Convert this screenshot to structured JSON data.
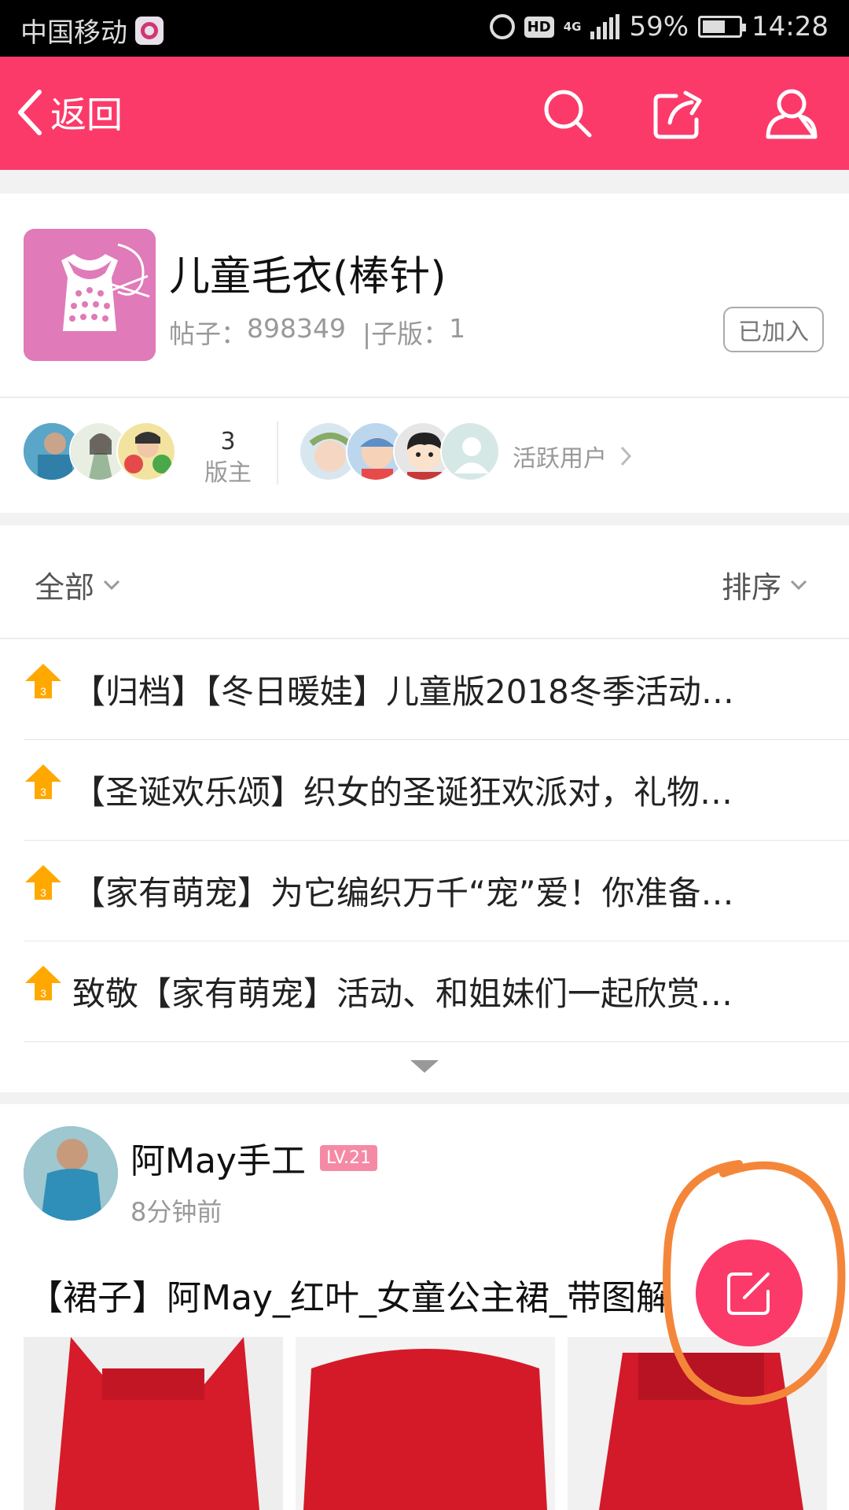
{
  "status_bar": {
    "carrier": "中国移动",
    "network": "4G",
    "battery": "59%",
    "time": "14:28"
  },
  "header": {
    "back_label": "返回"
  },
  "forum": {
    "title": "儿童毛衣(棒针)",
    "posts_label": "帖子：",
    "posts_count": "898349",
    "subforum_label": "  |子版：",
    "subforum_count": "1",
    "joined_label": "已加入"
  },
  "members": {
    "moderator_count": "3",
    "moderator_label": "版主",
    "active_users_label": "活跃用户"
  },
  "filter": {
    "all_label": "全部",
    "sort_label": "排序"
  },
  "pinned_posts": [
    "【归档】【冬日暖娃】儿童版2018冬季活动…",
    "【圣诞欢乐颂】织女的圣诞狂欢派对，礼物…",
    "【家有萌宠】为它编织万千“宠”爱！你准备…",
    "致敬【家有萌宠】活动、和姐妹们一起欣赏…"
  ],
  "post": {
    "author": "阿May手工",
    "level": "LV.21",
    "time": "8分钟前",
    "title": "【裙子】阿May_红叶_女童公主裙_带图解"
  },
  "colors": {
    "brand": "#fb3a6a",
    "pin_icon": "#ffa800",
    "annotation": "#f4863a"
  }
}
